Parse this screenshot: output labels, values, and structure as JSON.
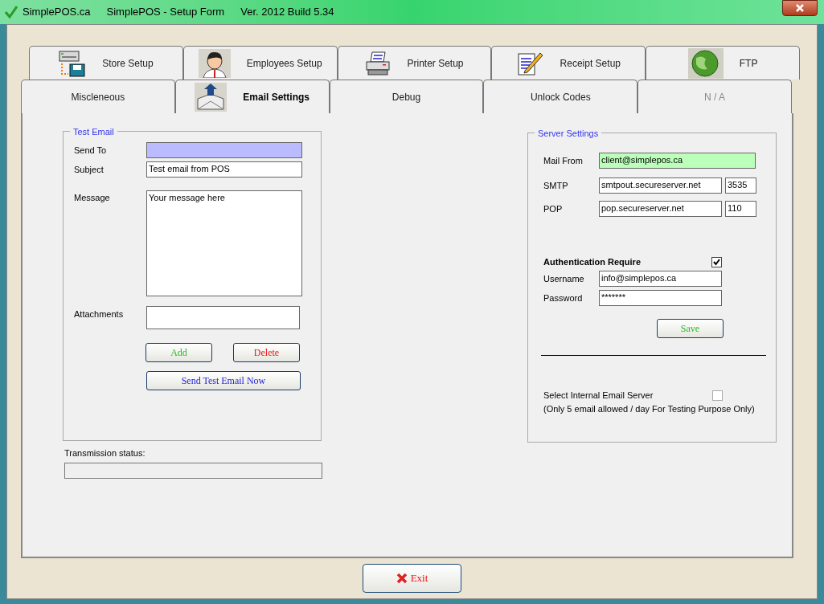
{
  "title_bar": {
    "app": "SimplePOS.ca",
    "title": "SimplePOS - Setup Form",
    "version": "Ver. 2012 Build 5.34"
  },
  "tabs_row1": [
    {
      "label": "Store Setup",
      "kind": "store",
      "selected": false,
      "disabled": false
    },
    {
      "label": "Employees Setup",
      "kind": "employee",
      "selected": false,
      "disabled": false
    },
    {
      "label": "Printer Setup",
      "kind": "printer",
      "selected": false,
      "disabled": false
    },
    {
      "label": "Receipt Setup",
      "kind": "receipt",
      "selected": false,
      "disabled": false
    },
    {
      "label": "FTP",
      "kind": "ftp",
      "selected": false,
      "disabled": false
    }
  ],
  "tabs_row2": [
    {
      "label": "Miscleneous",
      "kind": "text",
      "selected": false,
      "disabled": false
    },
    {
      "label": "Email Settings",
      "kind": "email",
      "selected": true,
      "disabled": false
    },
    {
      "label": "Debug",
      "kind": "text",
      "selected": false,
      "disabled": false
    },
    {
      "label": "Unlock Codes",
      "kind": "text",
      "selected": false,
      "disabled": false
    },
    {
      "label": "N / A",
      "kind": "text",
      "selected": false,
      "disabled": true
    }
  ],
  "test_email": {
    "title": "Test Email",
    "send_to": {
      "label": "Send To"
    },
    "subject": {
      "label": "Subject",
      "value": "Test email from POS"
    },
    "message": {
      "label": "Message",
      "value": "Your message here"
    },
    "attachments": {
      "label": "Attachments"
    },
    "buttons": [
      {
        "label": "Add",
        "kind": "add"
      },
      {
        "label": "Delete",
        "kind": "delete"
      },
      {
        "label": "Send Test Email Now",
        "kind": "send"
      }
    ]
  },
  "transmission_status": {
    "label": "Transmission status:",
    "level": 0
  },
  "server_settings": {
    "title": "Server Settings",
    "mail_from": {
      "label": "Mail From",
      "value": "client@simplepos.ca"
    },
    "smtp": {
      "label": "SMTP",
      "host": "smtpout.secureserver.net",
      "port": "3535"
    },
    "pop": {
      "label": "POP",
      "host": "pop.secureserver.net",
      "port": "110"
    },
    "auth": {
      "label": "Authentication Require",
      "checked": true
    },
    "username": {
      "label": "Username",
      "value": "info@simplepos.ca"
    },
    "password": {
      "label": "Password",
      "value": "*******"
    },
    "save_button": "Save",
    "internal_server": {
      "label": "Select Internal Email Server",
      "note": "(Only 5 email allowed / day For Testing Purpose Only)",
      "checked": false
    }
  },
  "exit_button": "Exit"
}
